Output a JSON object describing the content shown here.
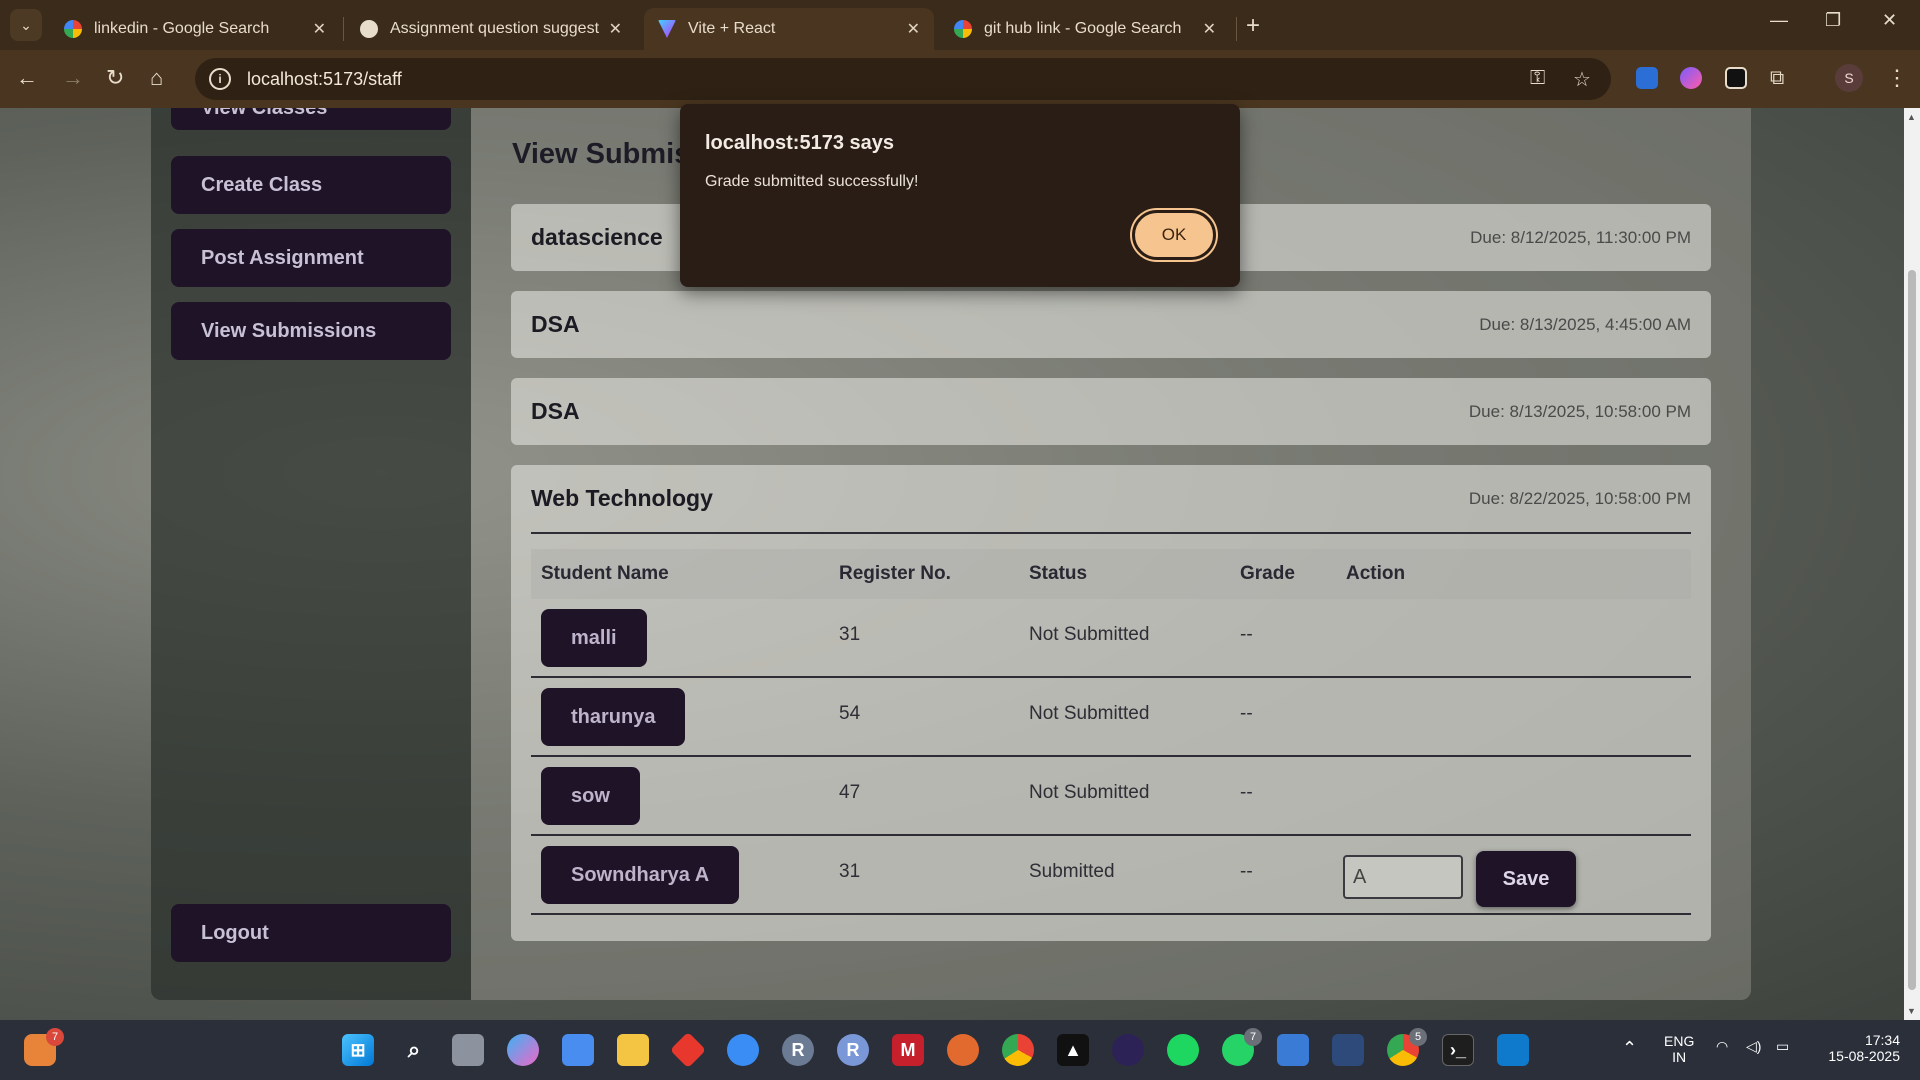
{
  "browser": {
    "tabs": [
      {
        "title": "linkedin - Google Search"
      },
      {
        "title": "Assignment question suggestio"
      },
      {
        "title": "Vite + React"
      },
      {
        "title": "git hub link - Google Search"
      }
    ],
    "url": "localhost:5173/staff",
    "profile_initial": "S"
  },
  "sidebar": {
    "items": [
      {
        "label": "View Classes"
      },
      {
        "label": "Create Class"
      },
      {
        "label": "Post Assignment"
      },
      {
        "label": "View Submissions"
      }
    ],
    "logout_label": "Logout"
  },
  "main": {
    "title": "View Submissions",
    "assignments": [
      {
        "name": "datascience",
        "due": "Due: 8/12/2025, 11:30:00 PM"
      },
      {
        "name": "DSA",
        "due": "Due: 8/13/2025, 4:45:00 AM"
      },
      {
        "name": "DSA",
        "due": "Due: 8/13/2025, 10:58:00 PM"
      },
      {
        "name": "Web Technology",
        "due": "Due: 8/22/2025, 10:58:00 PM"
      }
    ],
    "table": {
      "headers": [
        "Student Name",
        "Register No.",
        "Status",
        "Grade",
        "Action"
      ],
      "rows": [
        {
          "name": "malli",
          "reg": "31",
          "status": "Not Submitted",
          "grade": "--"
        },
        {
          "name": "tharunya",
          "reg": "54",
          "status": "Not Submitted",
          "grade": "--"
        },
        {
          "name": "sow",
          "reg": "47",
          "status": "Not Submitted",
          "grade": "--"
        },
        {
          "name": "Sowndharya A",
          "reg": "31",
          "status": "Submitted",
          "grade": "--",
          "grade_input": "A",
          "save_label": "Save"
        }
      ]
    }
  },
  "dialog": {
    "title": "localhost:5173 says",
    "message": "Grade submitted successfully!",
    "ok_label": "OK"
  },
  "taskbar": {
    "lang_line1": "ENG",
    "lang_line2": "IN",
    "time": "17:34",
    "date": "15-08-2025",
    "badges": {
      "left_app": "7",
      "whatsapp": "7",
      "chrome": "5"
    }
  },
  "colors": {
    "chrome_bg": "#3a2b1a",
    "sidebar_button": "#1e1327",
    "dialog_ok": "#f6c48e"
  }
}
